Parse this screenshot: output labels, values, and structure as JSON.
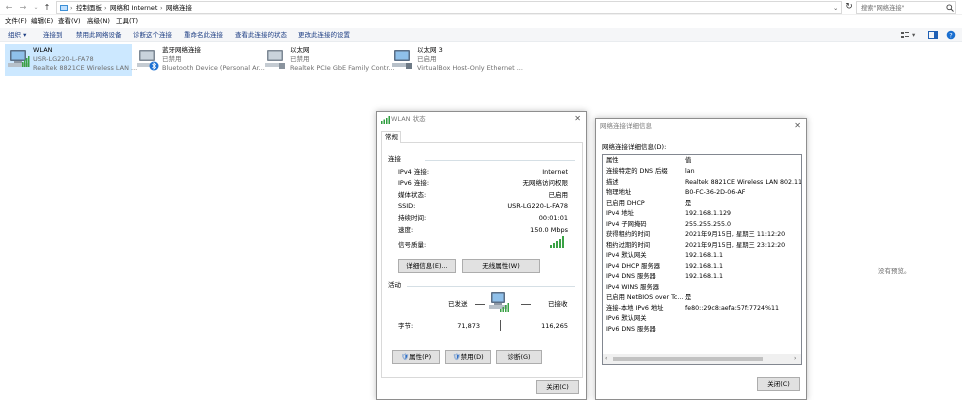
{
  "address": {
    "crumbs": [
      "控制面板",
      "网络和 Internet",
      "网络连接"
    ],
    "search_placeholder": "搜索\"网络连接\""
  },
  "menu": [
    "文件(F)",
    "编辑(E)",
    "查看(V)",
    "高级(N)",
    "工具(T)"
  ],
  "commands": [
    "组织 ▾",
    "连接到",
    "禁用此网络设备",
    "诊断这个连接",
    "重命名此连接",
    "查看此连接的状态",
    "更改此连接的设置"
  ],
  "adapters": [
    {
      "name": "WLAN",
      "status": "USR-LG220-L-FA78",
      "device": "Realtek 8821CE Wireless LAN ..."
    },
    {
      "name": "蓝牙网络连接",
      "status": "已禁用",
      "device": "Bluetooth Device (Personal Ar..."
    },
    {
      "name": "以太网",
      "status": "已禁用",
      "device": "Realtek PCIe GbE Family Contr..."
    },
    {
      "name": "以太网 3",
      "status": "已启用",
      "device": "VirtualBox Host-Only Ethernet ..."
    }
  ],
  "status_dialog": {
    "title": "WLAN 状态",
    "tab": "常规",
    "connection_header": "连接",
    "rows": [
      {
        "label": "IPv4 连接:",
        "value": "Internet"
      },
      {
        "label": "IPv6 连接:",
        "value": "无网络访问权限"
      },
      {
        "label": "媒体状态:",
        "value": "已启用"
      },
      {
        "label": "SSID:",
        "value": "USR-LG220-L-FA78"
      },
      {
        "label": "持续时间:",
        "value": "00:01:01"
      },
      {
        "label": "速度:",
        "value": "150.0 Mbps"
      },
      {
        "label": "信号质量:",
        "value": ""
      }
    ],
    "btn_details": "详细信息(E)...",
    "btn_wireless": "无线属性(W)",
    "activity_header": "活动",
    "sent_label": "已发送",
    "received_label": "已接收",
    "bytes_label": "字节:",
    "bytes_sent": "71,873",
    "bytes_received": "116,265",
    "btn_properties": "属性(P)",
    "btn_disable": "禁用(D)",
    "btn_diagnose": "诊断(G)",
    "btn_close": "关闭(C)"
  },
  "details_dialog": {
    "title": "网络连接详细信息",
    "caption": "网络连接详细信息(D):",
    "header": {
      "property": "属性",
      "value": "值"
    },
    "rows": [
      {
        "property": "连接特定的 DNS 后缀",
        "value": "lan"
      },
      {
        "property": "描述",
        "value": "Realtek 8821CE Wireless LAN 802.11ac"
      },
      {
        "property": "物理地址",
        "value": "B0-FC-36-2D-06-AF"
      },
      {
        "property": "已启用 DHCP",
        "value": "是"
      },
      {
        "property": "IPv4 地址",
        "value": "192.168.1.129"
      },
      {
        "property": "IPv4 子网掩码",
        "value": "255.255.255.0"
      },
      {
        "property": "获得租约的时间",
        "value": "2021年9月15日, 星期三 11:12:20"
      },
      {
        "property": "租约过期的时间",
        "value": "2021年9月15日, 星期三 23:12:20"
      },
      {
        "property": "IPv4 默认网关",
        "value": "192.168.1.1"
      },
      {
        "property": "IPv4 DHCP 服务器",
        "value": "192.168.1.1"
      },
      {
        "property": "IPv4 DNS 服务器",
        "value": "192.168.1.1"
      },
      {
        "property": "IPv4 WINS 服务器",
        "value": ""
      },
      {
        "property": "已启用 NetBIOS over Tc...",
        "value": "是"
      },
      {
        "property": "连接-本地 IPv6 地址",
        "value": "fe80::29c8:aefa:57f:7724%11"
      },
      {
        "property": "IPv6 默认网关",
        "value": ""
      },
      {
        "property": "IPv6 DNS 服务器",
        "value": ""
      }
    ],
    "btn_close": "关闭(C)"
  },
  "preview_text": "没有预览。"
}
